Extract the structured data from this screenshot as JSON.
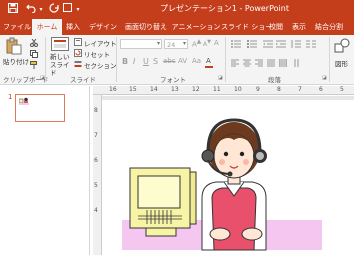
{
  "titlebar": {
    "title": "プレゼンテーション1 - PowerPoint",
    "save_icon": "save-icon",
    "undo_icon": "undo-icon",
    "redo_icon": "redo-icon"
  },
  "tabs": [
    "ファイル",
    "ホーム",
    "挿入",
    "デザイン",
    "画面切り替え",
    "アニメーション",
    "スライド ショー",
    "校閲",
    "表示",
    "結合分割"
  ],
  "active_tab": "ホーム",
  "ribbon": {
    "paste_label": "貼り付け",
    "new_slide_label": "新しい\nスライド",
    "layout_label": "レイアウト",
    "reset_label": "リセット",
    "section_label": "セクション",
    "font_size": "24",
    "groups": {
      "clipboard": "クリップボード",
      "slides": "スライド",
      "font": "フォント",
      "paragraph": "段落",
      "drawing": "図形"
    }
  },
  "slides_panel": {
    "slide_number": "1"
  },
  "ruler": {
    "h_ticks": [
      "16",
      "15",
      "14",
      "13",
      "12",
      "11",
      "10",
      "9",
      "8",
      "7",
      "6",
      "5"
    ],
    "v_ticks": [
      "8",
      "7",
      "6",
      "5",
      "4"
    ]
  },
  "colors": {
    "accent": "#c43e1c",
    "ribbon_bg": "#f4f4f4",
    "desk": "#f5c6f0",
    "monitor": "#f7f4a6",
    "vest": "#e8506c"
  }
}
